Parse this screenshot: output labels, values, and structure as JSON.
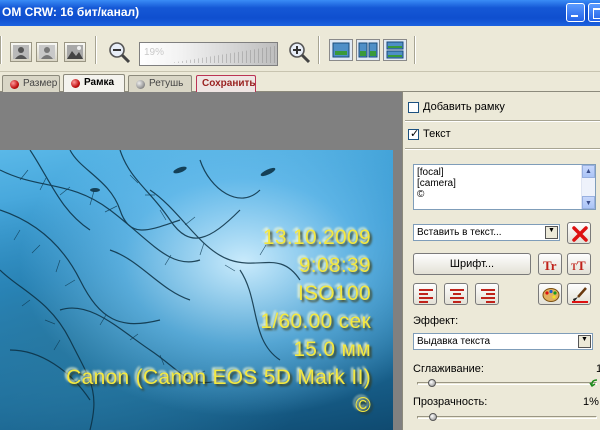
{
  "window": {
    "title": "OM CRW: 16 бит/канал)"
  },
  "toolbar": {
    "zoom_percent": "19%",
    "icons": [
      "person-icon",
      "person-icon",
      "landscape-icon",
      "zoom-out-icon",
      "zoom-in-icon",
      "single-view-icon",
      "split-view-icon",
      "stacked-view-icon"
    ]
  },
  "tabs": [
    {
      "label": "Размер",
      "state": "inactive"
    },
    {
      "label": "Рамка",
      "state": "active"
    },
    {
      "label": "Ретушь",
      "state": "inactive"
    },
    {
      "label": "Сохранить",
      "state": "action"
    }
  ],
  "photo_overlay": {
    "lines": [
      "13.10.2009",
      "9:08:39",
      "ISO100",
      "1/60.00 сек",
      "15.0 мм",
      "Canon (Canon EOS 5D Mark II)",
      "©"
    ],
    "text_color": "#f4e840"
  },
  "panel": {
    "add_frame_label": "Добавить рамку",
    "add_frame_checked": false,
    "text_label": "Текст",
    "text_checked": true,
    "text_lines": [
      "[focal]",
      "[camera]",
      "©"
    ],
    "insert_combo_value": "Вставить в текст...",
    "font_button_label": "Шрифт...",
    "effect_label": "Эффект:",
    "effect_value": "Выдавка текста",
    "smoothing_label": "Сглаживание:",
    "smoothing_value": "1",
    "transparency_label": "Прозрачность:",
    "transparency_value": "1%"
  }
}
